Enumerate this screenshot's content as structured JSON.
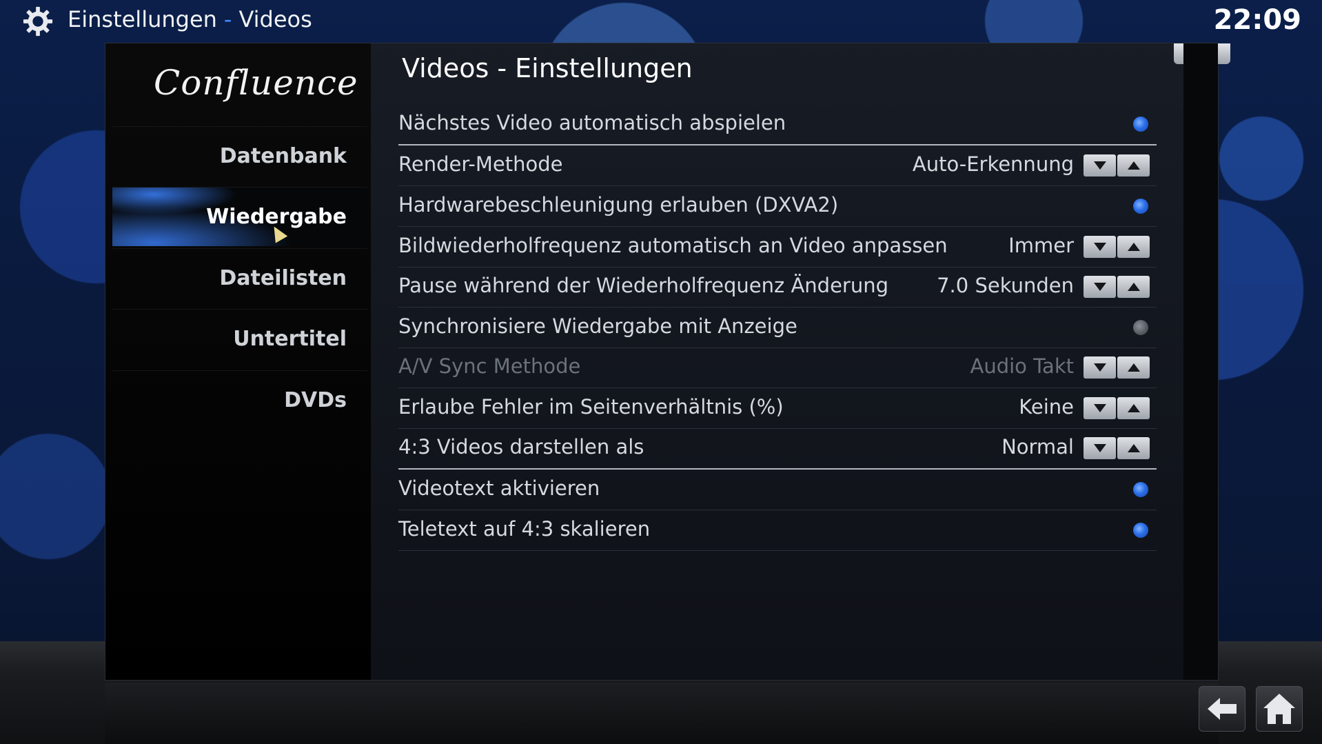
{
  "topbar": {
    "breadcrumb_section": "Einstellungen",
    "breadcrumb_separator": "-",
    "breadcrumb_page": "Videos",
    "clock": "22:09",
    "icon": "gear-icon"
  },
  "sidebar": {
    "logo": "Confluence",
    "items": [
      {
        "label": "Datenbank",
        "active": false
      },
      {
        "label": "Wiedergabe",
        "active": true
      },
      {
        "label": "Dateilisten",
        "active": false
      },
      {
        "label": "Untertitel",
        "active": false
      },
      {
        "label": "DVDs",
        "active": false
      }
    ]
  },
  "panel": {
    "title": "Videos - Einstellungen",
    "close_label": "×",
    "settings": [
      {
        "label": "Nächstes Video automatisch abspielen",
        "type": "toggle",
        "on": true
      },
      {
        "label": "Render-Methode",
        "type": "spin",
        "value": "Auto-Erkennung"
      },
      {
        "label": "Hardwarebeschleunigung erlauben (DXVA2)",
        "type": "toggle",
        "on": true
      },
      {
        "label": "Bildwiederholfrequenz automatisch an Video anpassen",
        "type": "spin",
        "value": "Immer"
      },
      {
        "label": "Pause während der Wiederholfrequenz Änderung",
        "type": "spin",
        "value": "7.0 Sekunden"
      },
      {
        "label": "Synchronisiere Wiedergabe mit Anzeige",
        "type": "toggle",
        "on": false
      },
      {
        "label": "A/V Sync Methode",
        "type": "spin",
        "value": "Audio Takt",
        "disabled": true
      },
      {
        "label": "Erlaube Fehler im Seitenverhältnis (%)",
        "type": "spin",
        "value": "Keine"
      },
      {
        "label": "4:3 Videos darstellen als",
        "type": "spin",
        "value": "Normal"
      },
      {
        "label": "Videotext aktivieren",
        "type": "toggle",
        "on": true
      },
      {
        "label": "Teletext auf 4:3 skalieren",
        "type": "toggle",
        "on": true
      }
    ]
  },
  "footer": {
    "back_icon": "back-arrow-icon",
    "home_icon": "home-icon"
  },
  "colors": {
    "accent": "#3b8cff",
    "toggle_on": "#2b6ee8",
    "toggle_off": "#565a60"
  }
}
